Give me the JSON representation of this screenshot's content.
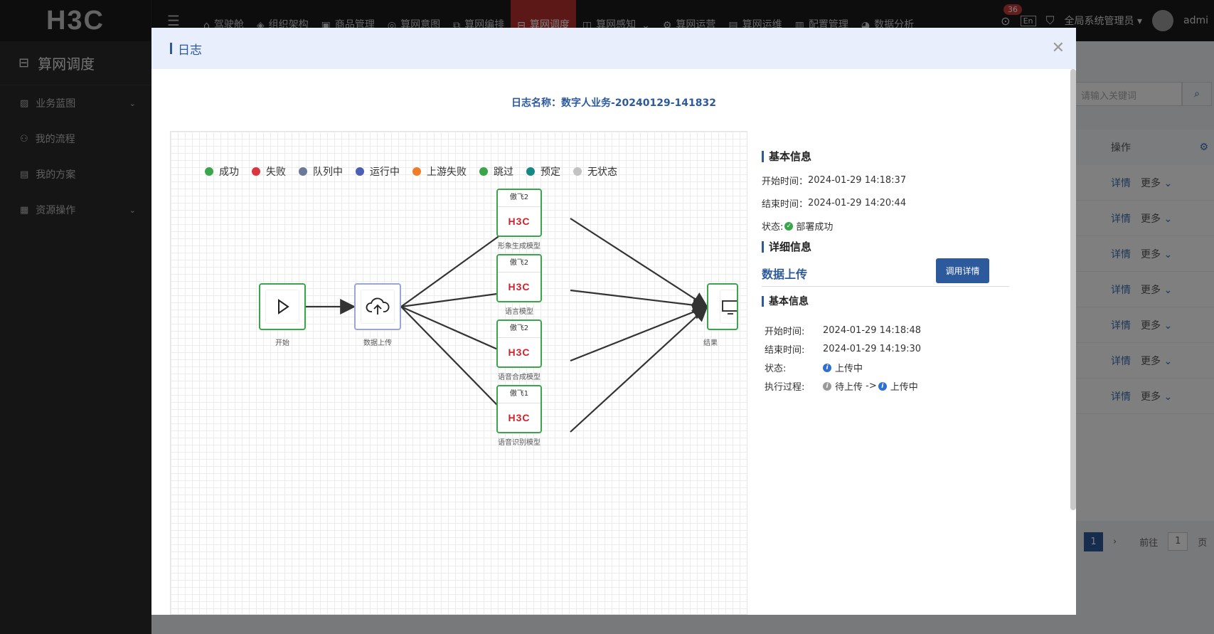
{
  "topbar": {
    "logo": "H3C",
    "nav": [
      {
        "icon": "home-icon",
        "glyph": "⌂",
        "label": "驾驶舱"
      },
      {
        "icon": "layers-icon",
        "glyph": "◈",
        "label": "组织架构"
      },
      {
        "icon": "product-icon",
        "glyph": "▣",
        "label": "商品管理"
      },
      {
        "icon": "bulb-icon",
        "glyph": "◎",
        "label": "算网意图"
      },
      {
        "icon": "orchestrate-icon",
        "glyph": "⧉",
        "label": "算网编排"
      },
      {
        "icon": "schedule-icon",
        "glyph": "⊟",
        "label": "算网调度"
      },
      {
        "icon": "perception-icon",
        "glyph": "◫",
        "label": "算网感知"
      },
      {
        "icon": "operation-icon",
        "glyph": "⚙",
        "label": "算网运营"
      },
      {
        "icon": "chart-icon",
        "glyph": "▤",
        "label": "算网运维"
      },
      {
        "icon": "config-icon",
        "glyph": "▥",
        "label": "配置管理"
      },
      {
        "icon": "pie-icon",
        "glyph": "◕",
        "label": "数据分析"
      }
    ],
    "active_nav": "算网调度",
    "perception_chevron": "⌄",
    "notifications": "36",
    "lang": "En",
    "user_role": "全局系统管理员",
    "user_name": "admi"
  },
  "sidebar": {
    "title": "算网调度",
    "items": [
      {
        "label": "业务蓝图",
        "has_children": true
      },
      {
        "label": "我的流程",
        "has_children": false
      },
      {
        "label": "我的方案",
        "has_children": false
      },
      {
        "label": "资源操作",
        "has_children": true
      }
    ]
  },
  "background": {
    "search_placeholder": "请输入关键词",
    "column_action": "操作",
    "row_detail": "详情",
    "row_more": "更多",
    "rows": 7,
    "page_current": "1",
    "page_goto": "前往",
    "page_input": "1",
    "page_suffix": "页"
  },
  "modal": {
    "title": "日志",
    "log_name_label": "日志名称：",
    "log_name": "数字人业务-20240129-141832",
    "legend": [
      {
        "label": "成功",
        "color": "#3aa54a"
      },
      {
        "label": "失败",
        "color": "#d9363e"
      },
      {
        "label": "队列中",
        "color": "#6b7a99"
      },
      {
        "label": "运行中",
        "color": "#4a5fb5"
      },
      {
        "label": "上游失败",
        "color": "#f07c2a"
      },
      {
        "label": "跳过",
        "color": "#3aa54a"
      },
      {
        "label": "预定",
        "color": "#158a84"
      },
      {
        "label": "无状态",
        "color": "#c2c2c2"
      }
    ],
    "nodes": {
      "start": "开始",
      "upload": "数据上传",
      "result": "结果",
      "models": [
        {
          "tag": "傲飞2",
          "logo": "H3C",
          "label": "形象生成模型"
        },
        {
          "tag": "傲飞2",
          "logo": "H3C",
          "label": "语言模型"
        },
        {
          "tag": "傲飞2",
          "logo": "H3C",
          "label": "语音合成模型"
        },
        {
          "tag": "傲飞1",
          "logo": "H3C",
          "label": "语音识别模型"
        }
      ]
    },
    "basic": {
      "title": "基本信息",
      "start_label": "开始时间：",
      "start": "2024-01-29 14:18:37",
      "end_label": "结束时间：",
      "end": "2024-01-29 14:20:44",
      "status_label": "状态:",
      "status": "部署成功"
    },
    "detail": {
      "title": "详细信息",
      "node_name": "数据上传",
      "button": "调用详情",
      "sub_title": "基本信息",
      "start_label": "开始时间:",
      "start": "2024-01-29 14:18:48",
      "end_label": "结束时间:",
      "end": "2024-01-29 14:19:30",
      "status_label": "状态:",
      "status": "上传中",
      "process_label": "执行过程:",
      "process_from": "待上传",
      "process_arrow": "->",
      "process_to": "上传中"
    }
  }
}
